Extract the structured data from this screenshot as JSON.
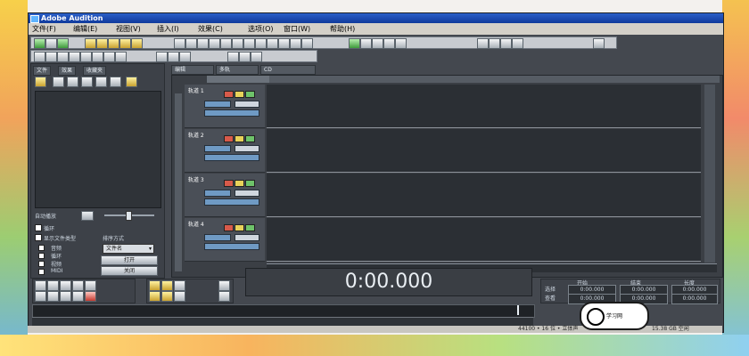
{
  "window": {
    "title": "Adobe Audition"
  },
  "menu": [
    "文件(F)",
    "编辑(E)",
    "视图(V)",
    "插入(I)",
    "效果(C)",
    "选项(O)",
    "窗口(W)",
    "帮助(H)"
  ],
  "left_panel": {
    "tabs": [
      "文件",
      "效果",
      "收藏夹"
    ],
    "auto_play_label": "自动播放",
    "loop_label": "循环",
    "show_types_label": "显示文件类型",
    "type_options": [
      "音频",
      "循环",
      "视频",
      "MIDI"
    ],
    "sort_label": "排序方式",
    "sort_value": "文件名",
    "btn_open": "打开",
    "btn_close": "关闭"
  },
  "session_tabs": [
    "编辑",
    "多轨",
    "CD"
  ],
  "tracks": [
    {
      "name": "轨道 1"
    },
    {
      "name": "轨道 2"
    },
    {
      "name": "轨道 3"
    },
    {
      "name": "轨道 4"
    }
  ],
  "transport": {
    "time_display": "0:00.000"
  },
  "selection_view": {
    "labels": [
      "开始",
      "结束",
      "长度"
    ],
    "row_labels": [
      "选择",
      "查看"
    ],
    "values": [
      "0:00.000",
      "0:00.000",
      "0:00.000",
      "0:00.000",
      "0:00.000",
      "0:00.000"
    ]
  },
  "status_bar": {
    "format": "44100 • 16 位 • 立体声",
    "time": "0:00.000",
    "disk": "15.38 GB 空闲"
  },
  "badge": {
    "text": "学习网"
  }
}
